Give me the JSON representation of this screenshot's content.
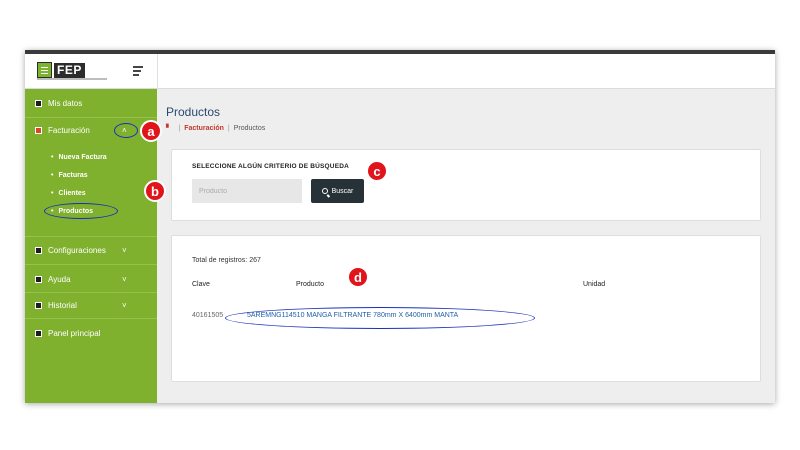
{
  "header": {
    "logo_text": "FEP"
  },
  "sidebar": {
    "items": [
      {
        "label": "Mis datos"
      },
      {
        "label": "Facturación",
        "chevron": "˄"
      },
      {
        "label": "Configuraciones",
        "chevron": "˅"
      },
      {
        "label": "Ayuda",
        "chevron": "˅"
      },
      {
        "label": "Historial",
        "chevron": "˅"
      },
      {
        "label": "Panel principal"
      }
    ],
    "sub_items": [
      {
        "label": "Nueva Factura"
      },
      {
        "label": "Facturas"
      },
      {
        "label": "Clientes"
      },
      {
        "label": "Productos"
      }
    ]
  },
  "main": {
    "title": "Productos",
    "breadcrumb": {
      "section": "Facturación",
      "current": "Productos"
    },
    "search": {
      "heading": "SELECCIONE ALGÚN CRITERIO DE BÚSQUEDA",
      "placeholder": "Producto",
      "button_label": "Buscar"
    },
    "results": {
      "total": "Total de registros: 267",
      "columns": [
        "Clave",
        "Producto",
        "Unidad"
      ],
      "rows": [
        {
          "clave": "40161505",
          "producto": "5AREMNG114510 MANGA FILTRANTE 780mm X 6400mm MANTA",
          "unidad": ""
        }
      ]
    }
  },
  "annotations": {
    "a": "a",
    "b": "b",
    "c": "c",
    "d": "d"
  },
  "colors": {
    "sidebar": "#7fb02e",
    "accent_red": "#e0141a",
    "ring_blue": "#1a2fbf",
    "link": "#1f5fa8"
  }
}
